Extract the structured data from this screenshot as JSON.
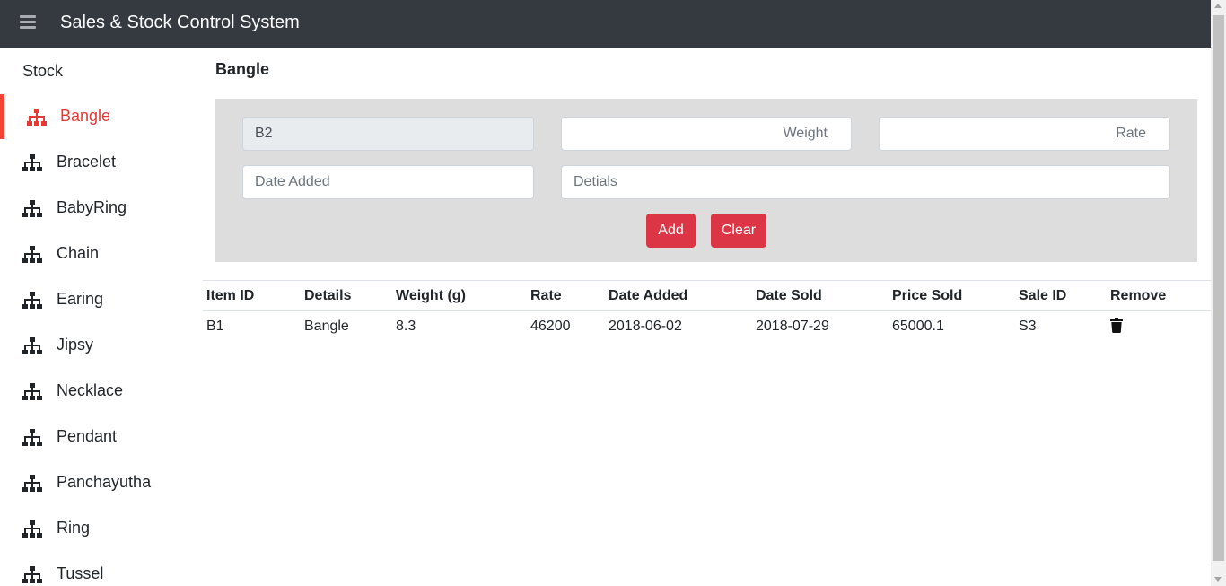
{
  "header": {
    "title": "Sales & Stock Control System",
    "menu_icon": "hamburger-icon"
  },
  "sidebar": {
    "heading": "Stock",
    "items": [
      {
        "label": "Bangle",
        "active": true
      },
      {
        "label": "Bracelet"
      },
      {
        "label": "BabyRing"
      },
      {
        "label": "Chain"
      },
      {
        "label": "Earing"
      },
      {
        "label": "Jipsy"
      },
      {
        "label": "Necklace"
      },
      {
        "label": "Pendant"
      },
      {
        "label": "Panchayutha"
      },
      {
        "label": "Ring"
      },
      {
        "label": "Tussel"
      }
    ],
    "item_icon": "sitemap-icon",
    "active_color": "#e53935"
  },
  "main": {
    "title": "Bangle",
    "form": {
      "item_id_value": "B2",
      "weight_placeholder": "Weight",
      "rate_placeholder": "Rate",
      "date_added_placeholder": "Date Added",
      "details_placeholder": "Detials",
      "add_label": "Add",
      "clear_label": "Clear"
    },
    "table": {
      "headers": [
        "Item ID",
        "Details",
        "Weight (g)",
        "Rate",
        "Date Added",
        "Date Sold",
        "Price Sold",
        "Sale ID",
        "Remove"
      ],
      "rows": [
        [
          "B1",
          "Bangle",
          "8.3",
          "46200",
          "2018-06-02",
          "2018-07-29",
          "65000.1",
          "S3"
        ]
      ],
      "remove_icon": "trash-icon"
    }
  },
  "colors": {
    "topbar": "#343a40",
    "accent": "#dc3545",
    "panel": "#dddddd"
  }
}
